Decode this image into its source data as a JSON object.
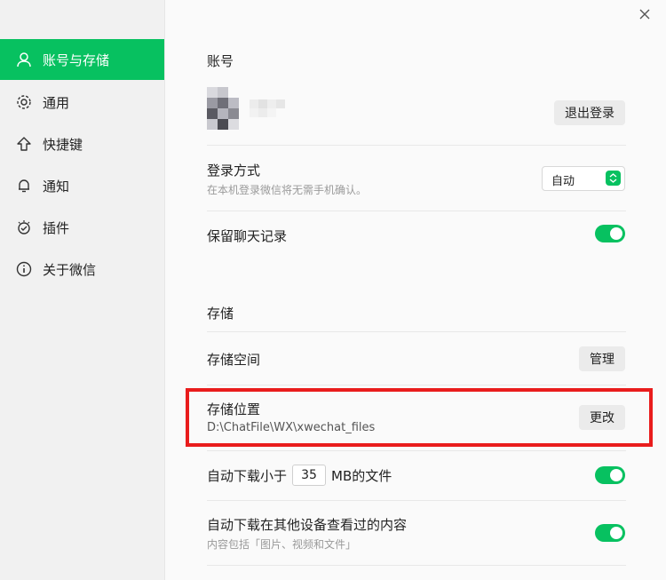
{
  "sidebar": {
    "items": [
      {
        "label": "账号与存储",
        "icon": "user-icon",
        "active": true
      },
      {
        "label": "通用",
        "icon": "gear-icon"
      },
      {
        "label": "快捷键",
        "icon": "arrow-up-icon"
      },
      {
        "label": "通知",
        "icon": "bell-icon"
      },
      {
        "label": "插件",
        "icon": "plugin-icon"
      },
      {
        "label": "关于微信",
        "icon": "info-icon"
      }
    ]
  },
  "account": {
    "section_title": "账号",
    "logout_label": "退出登录",
    "login_method_title": "登录方式",
    "login_method_sub": "在本机登录微信将无需手机确认。",
    "login_method_value": "自动",
    "keep_history_label": "保留聊天记录"
  },
  "storage": {
    "section_title": "存储",
    "space_label": "存储空间",
    "manage_label": "管理",
    "location_label": "存储位置",
    "location_path": "D:\\ChatFile\\WX\\xwechat_files",
    "change_label": "更改",
    "auto_dl_prefix": "自动下载小于",
    "auto_dl_value": "35",
    "auto_dl_suffix": "MB的文件",
    "auto_dl_other_label": "自动下载在其他设备查看过的内容",
    "auto_dl_other_sub": "内容包括「图片、视频和文件」"
  },
  "colors": {
    "accent": "#07c160",
    "highlight": "#e91c1c"
  }
}
